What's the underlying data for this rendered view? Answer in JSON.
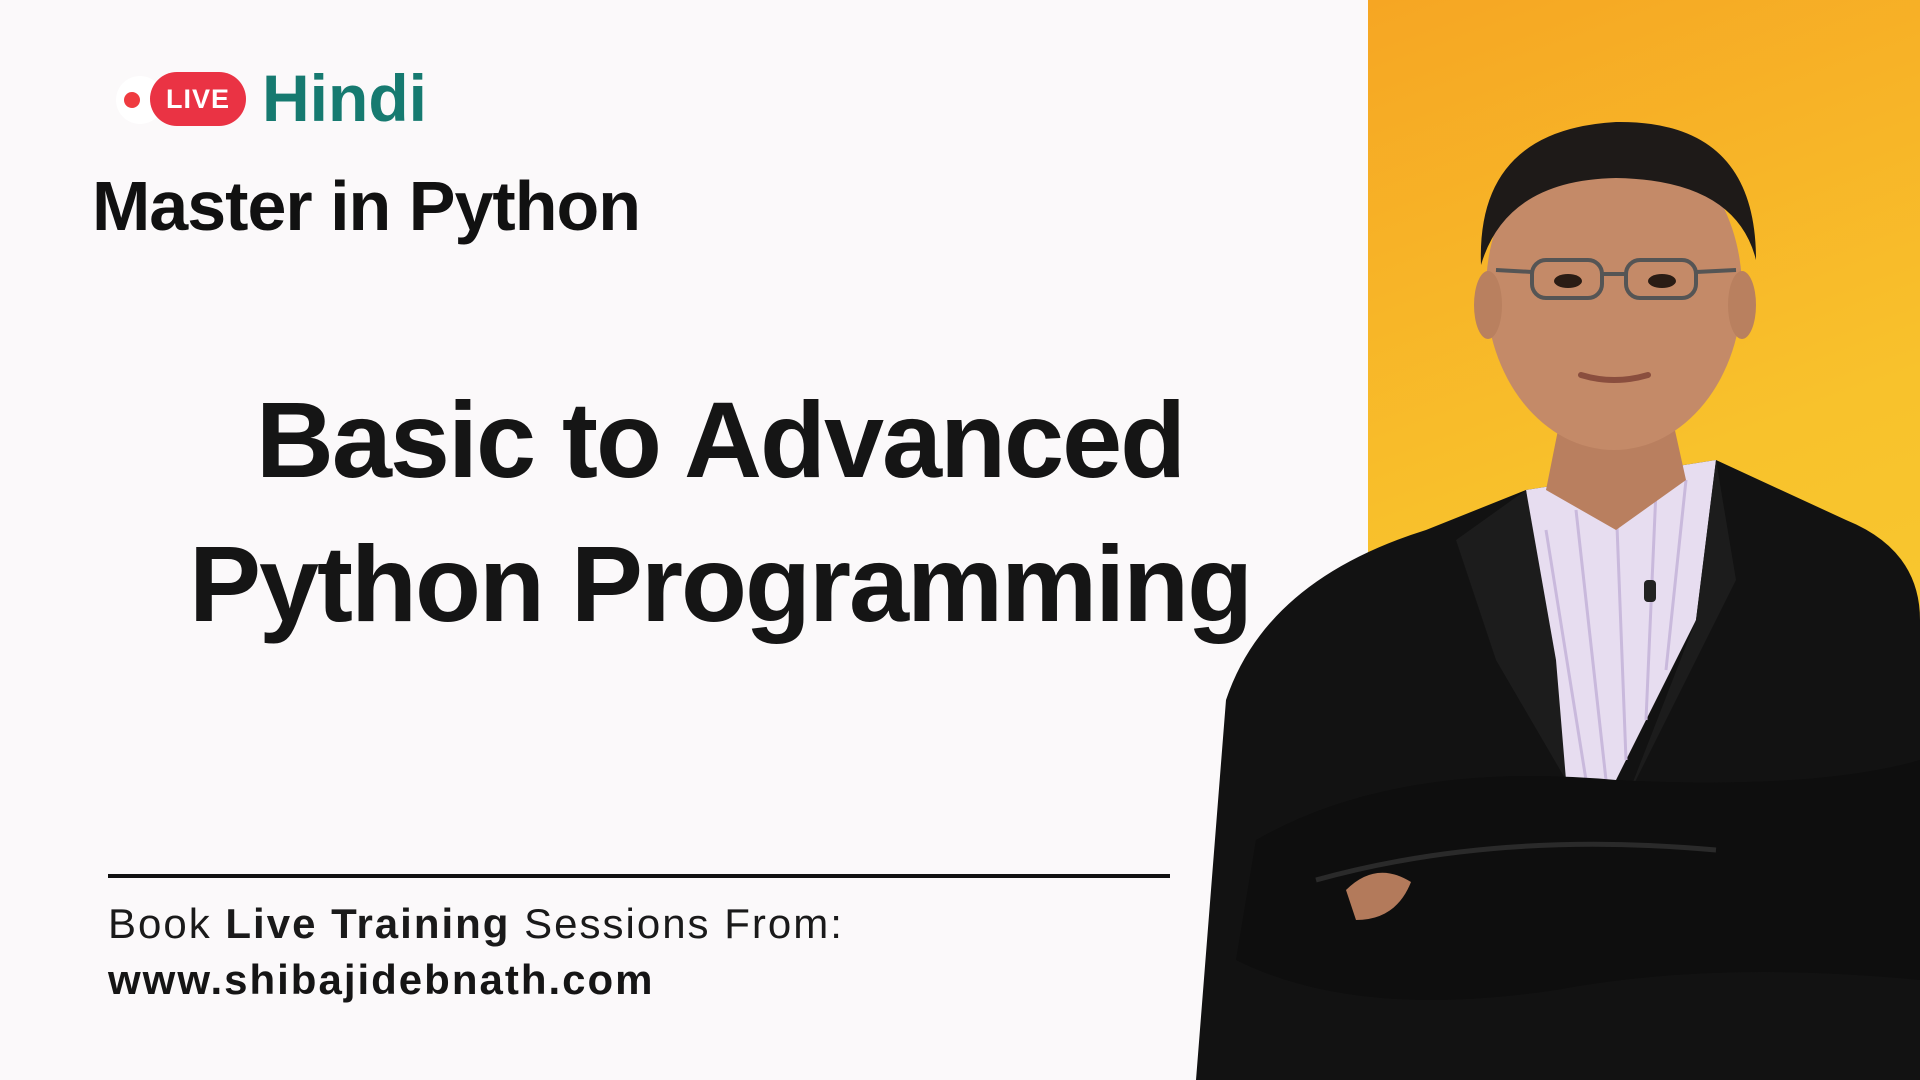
{
  "badge": {
    "live_label": "LIVE"
  },
  "header": {
    "language": "Hindi",
    "course_title": "Master in Python"
  },
  "headline": {
    "line1": "Basic to Advanced",
    "line2": "Python Programming"
  },
  "cta": {
    "prefix": "Book ",
    "emphasis": "Live Training",
    "suffix": " Sessions From:",
    "website": "www.shibajidebnath.com"
  },
  "colors": {
    "live_red": "#ea3344",
    "hindi_teal": "#167a70",
    "panel_yellow": "#f8c22c",
    "text_dark": "#151515"
  }
}
